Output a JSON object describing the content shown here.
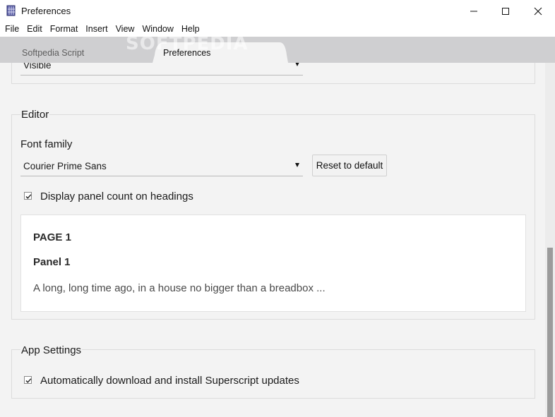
{
  "window": {
    "title": "Preferences",
    "icon": "app-icon",
    "controls": {
      "minimize": "minimize-icon",
      "maximize": "maximize-icon",
      "close": "close-icon"
    }
  },
  "menu": [
    "File",
    "Edit",
    "Format",
    "Insert",
    "View",
    "Window",
    "Help"
  ],
  "tabs": [
    {
      "label": "Softpedia Script",
      "active": false
    },
    {
      "label": "Preferences",
      "active": true
    }
  ],
  "watermark": "SOFTPEDIA",
  "previous_section": {
    "select_value": "Visible"
  },
  "editor": {
    "title": "Editor",
    "font_family_label": "Font family",
    "font_family_value": "Courier Prime Sans",
    "reset_label": "Reset to default",
    "panel_count_label": "Display panel count on headings",
    "panel_count_checked": true,
    "preview": {
      "page": "PAGE 1",
      "panel": "Panel 1",
      "text": "A long, long time ago, in a house no bigger than a breadbox ..."
    }
  },
  "app_settings": {
    "title": "App Settings",
    "auto_update_label": "Automatically download and install Superscript updates",
    "auto_update_checked": true
  },
  "colors": {
    "tab_bar": "#cfcfd1",
    "content_bg": "#f3f3f3",
    "scroll_thumb": "#9b9b9b"
  }
}
